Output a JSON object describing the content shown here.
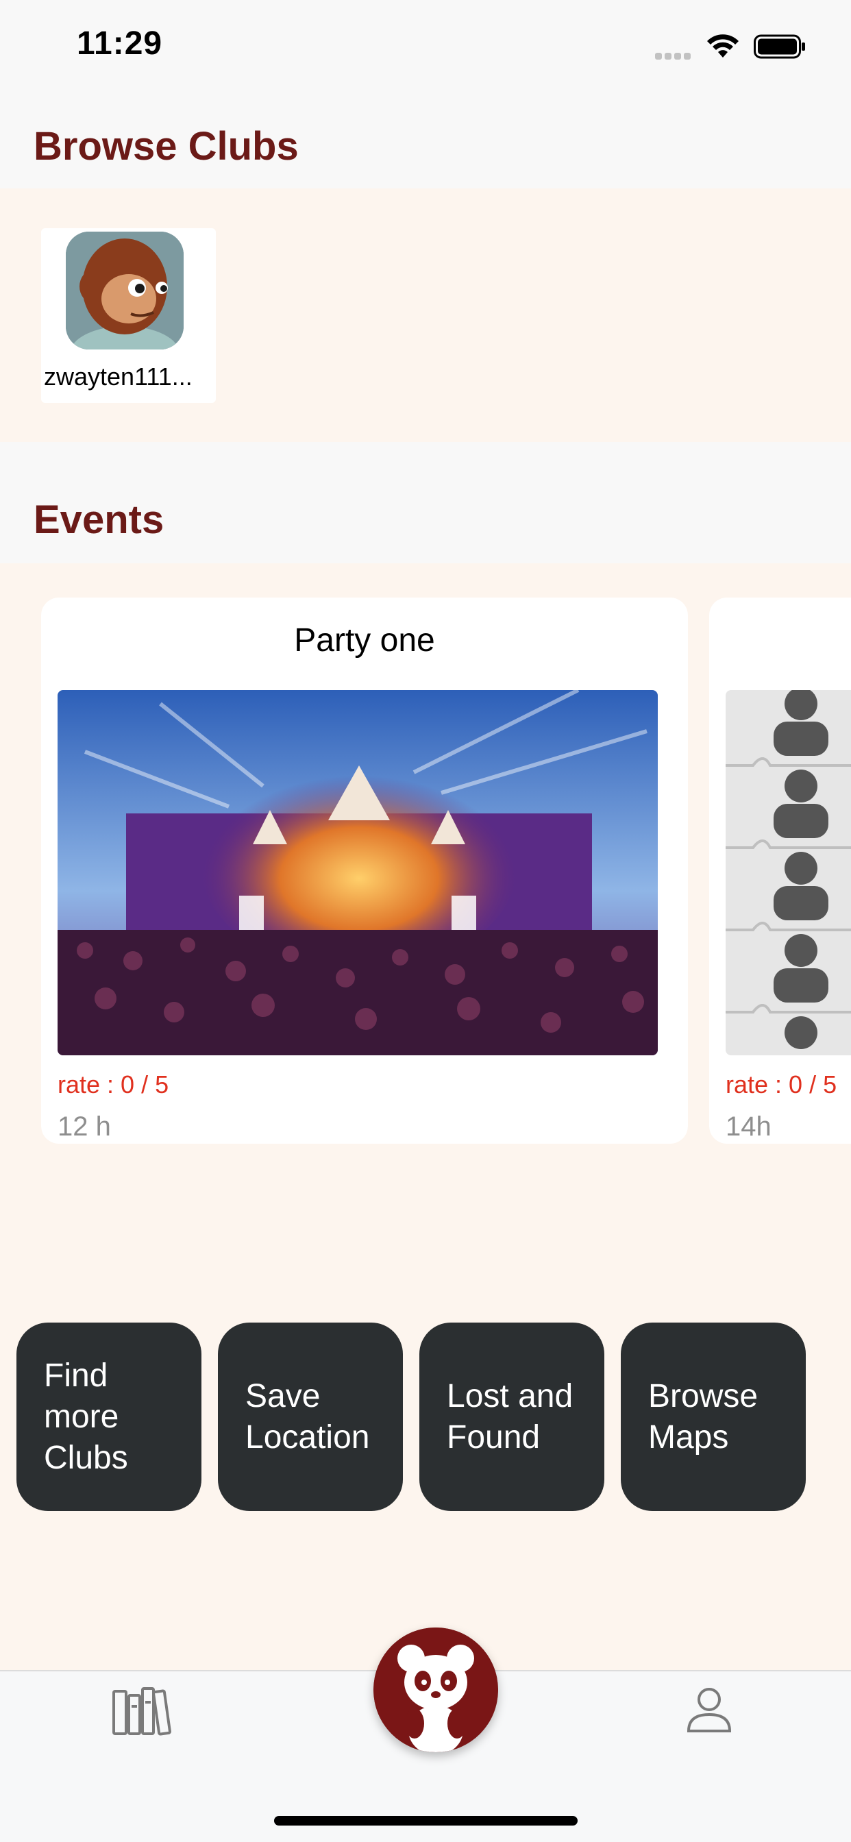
{
  "status_bar": {
    "time": "11:29"
  },
  "clubs": {
    "title": "Browse Clubs",
    "items": [
      {
        "name": "zwayten111..."
      }
    ]
  },
  "events": {
    "title": "Events",
    "items": [
      {
        "title": "Party one",
        "rate": "rate : 0 / 5",
        "time": "12 h"
      },
      {
        "title": "",
        "rate": "rate : 0 / 5",
        "time": "14h"
      }
    ]
  },
  "actions": {
    "find_more_clubs": "Find more Clubs",
    "save_location": "Save Location",
    "lost_and_found": "Lost and Found",
    "browse_maps": "Browse Maps"
  },
  "tab_bar": {
    "left_icon": "library-icon",
    "center_icon": "panda-logo-icon",
    "right_icon": "profile-icon"
  },
  "colors": {
    "accent": "#6b1a17",
    "band_background": "#fdf5ee",
    "button_background": "#2b2f31",
    "rate_red": "#e0301e",
    "logo_red": "#7a1616"
  }
}
